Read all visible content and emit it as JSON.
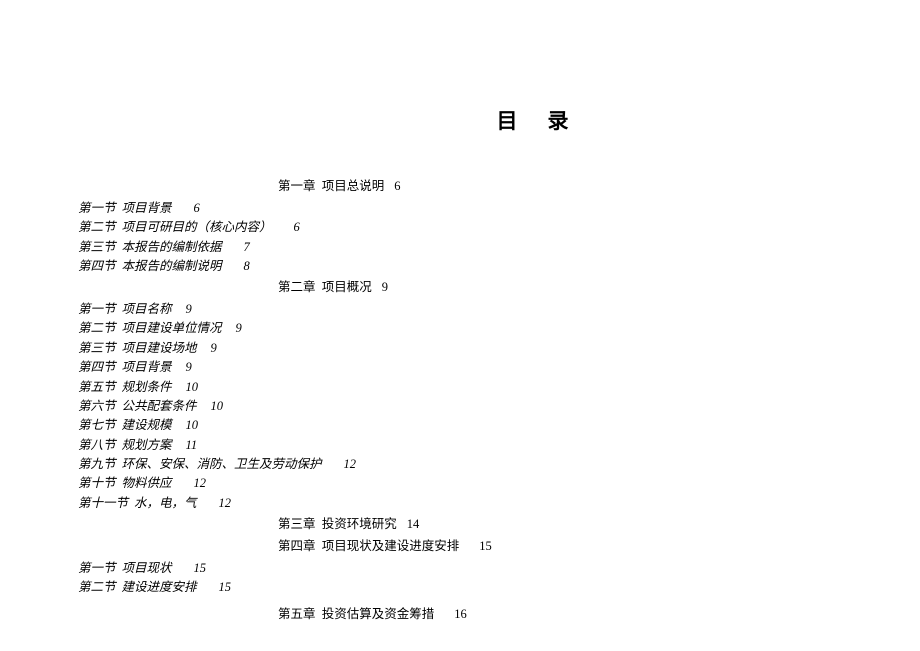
{
  "doc_title": "目录",
  "chapters": [
    {
      "label": "第一章",
      "title": "项目总说明",
      "page": "6"
    },
    {
      "label": "第二章",
      "title": "项目概况",
      "page": "9"
    },
    {
      "label": "第三章",
      "title": "投资环境研究",
      "page": "14"
    },
    {
      "label": "第四章",
      "title": "项目现状及建设进度安排",
      "page": "15"
    },
    {
      "label": "第五章",
      "title": "投资估算及资金筹措",
      "page": "16"
    }
  ],
  "sections_ch1": [
    {
      "label": "第一节",
      "title": "项目背景",
      "page": "6"
    },
    {
      "label": "第二节",
      "title": "项目可研目的（核心内容）",
      "page": "6"
    },
    {
      "label": "第三节",
      "title": "本报告的编制依据",
      "page": "7"
    },
    {
      "label": "第四节",
      "title": "本报告的编制说明",
      "page": "8"
    }
  ],
  "sections_ch2": [
    {
      "label": "第一节",
      "title": "项目名称",
      "page": "9"
    },
    {
      "label": "第二节",
      "title": "项目建设单位情况",
      "page": "9"
    },
    {
      "label": "第三节",
      "title": "项目建设场地",
      "page": "9"
    },
    {
      "label": "第四节",
      "title": "项目背景",
      "page": "9"
    },
    {
      "label": "第五节",
      "title": "规划条件",
      "page": "10"
    },
    {
      "label": "第六节",
      "title": "公共配套条件",
      "page": "10"
    },
    {
      "label": "第七节",
      "title": "建设规模",
      "page": "10"
    },
    {
      "label": "第八节",
      "title": "规划方案",
      "page": "11"
    },
    {
      "label": "第九节",
      "title": "环保、安保、消防、卫生及劳动保护",
      "page": "12"
    },
    {
      "label": "第十节",
      "title": "物料供应",
      "page": "12"
    },
    {
      "label": "第十一节",
      "title": "水，电，气",
      "page": "12"
    }
  ],
  "sections_ch4": [
    {
      "label": "第一节",
      "title": "项目现状",
      "page": "15"
    },
    {
      "label": "第二节",
      "title": "建设进度安排",
      "page": "15"
    }
  ]
}
